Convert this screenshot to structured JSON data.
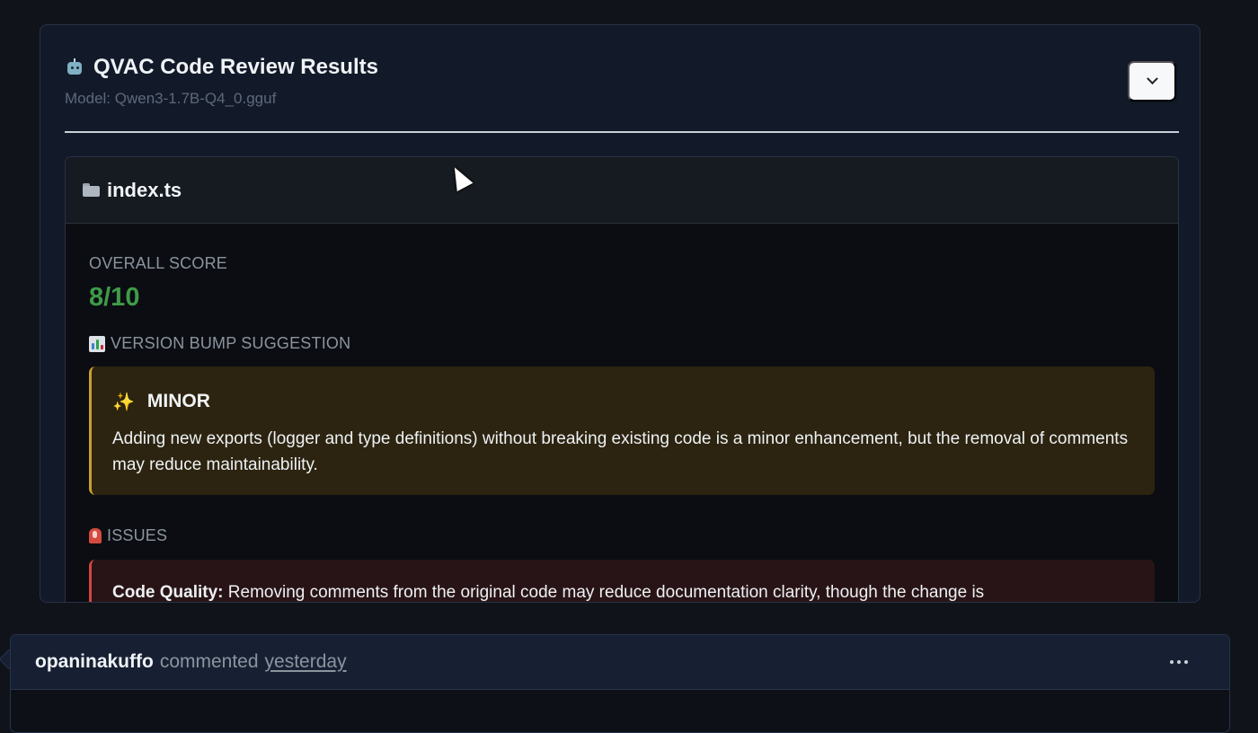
{
  "review": {
    "title": "QVAC Code Review Results",
    "model": "Model: Qwen3-1.7B-Q4_0.gguf"
  },
  "file": {
    "name": "index.ts",
    "overall_score_label": "OVERALL SCORE",
    "overall_score": "8/10",
    "version_label": "VERSION BUMP SUGGESTION",
    "bump_type": "MINOR",
    "bump_reason": "Adding new exports (logger and type definitions) without breaking existing code is a minor enhancement, but the removal of comments may reduce maintainability.",
    "issues_label": "ISSUES",
    "issues": [
      {
        "label": "Code Quality:",
        "text": "Removing comments from the original code may reduce documentation clarity, though the change is"
      }
    ]
  },
  "comment": {
    "author": "opaninakuffo",
    "action": "commented",
    "time": "yesterday"
  },
  "icons": {
    "robot": "robot-icon",
    "folder": "folder-icon",
    "chart": "bar-chart-icon",
    "sparkles": "sparkles-icon",
    "siren": "siren-icon",
    "more": "more-horizontal-icon",
    "chevron": "chevron-down-icon",
    "cursor": "mouse-cursor-icon"
  },
  "colors": {
    "score_green": "#3f9b48",
    "bump_accent": "#c7a02d",
    "issue_accent": "#d1473b"
  }
}
